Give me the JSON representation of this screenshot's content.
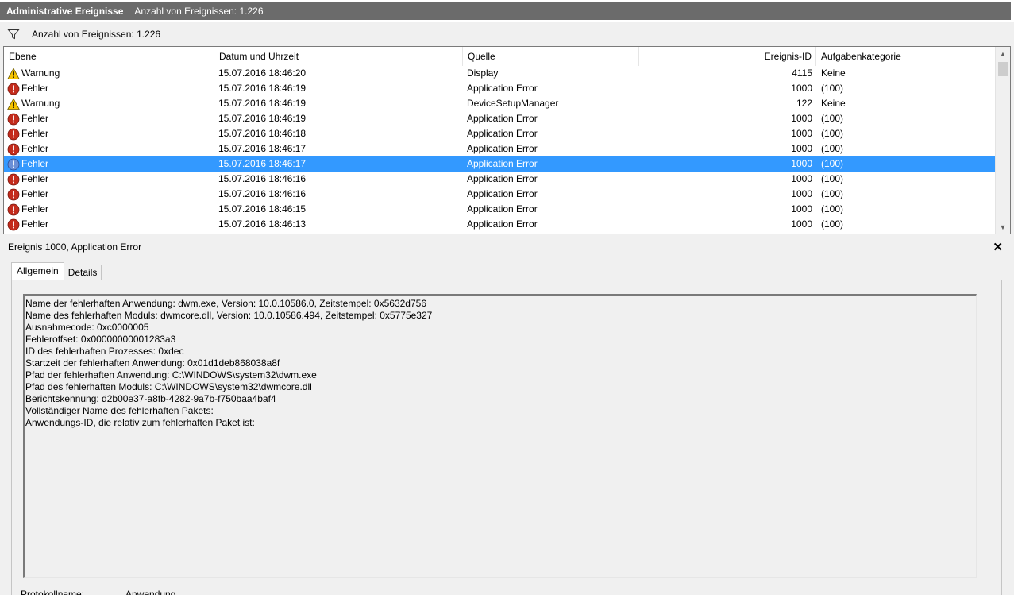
{
  "titlebar": {
    "title": "Administrative Ereignisse",
    "subtitle": "Anzahl von Ereignissen: 1.226"
  },
  "filterbar": {
    "text": "Anzahl von Ereignissen: 1.226",
    "icon": "filter-icon"
  },
  "grid": {
    "columns": [
      "Ebene",
      "Datum und Uhrzeit",
      "Quelle",
      "Ereignis-ID",
      "Aufgabenkategorie"
    ],
    "rows": [
      {
        "level": "Warnung",
        "icon": "warning-icon",
        "date": "15.07.2016 18:46:20",
        "source": "Display",
        "id": "4115",
        "category": "Keine"
      },
      {
        "level": "Fehler",
        "icon": "error-icon",
        "date": "15.07.2016 18:46:19",
        "source": "Application Error",
        "id": "1000",
        "category": "(100)"
      },
      {
        "level": "Warnung",
        "icon": "warning-icon",
        "date": "15.07.2016 18:46:19",
        "source": "DeviceSetupManager",
        "id": "122",
        "category": "Keine"
      },
      {
        "level": "Fehler",
        "icon": "error-icon",
        "date": "15.07.2016 18:46:19",
        "source": "Application Error",
        "id": "1000",
        "category": "(100)"
      },
      {
        "level": "Fehler",
        "icon": "error-icon",
        "date": "15.07.2016 18:46:18",
        "source": "Application Error",
        "id": "1000",
        "category": "(100)"
      },
      {
        "level": "Fehler",
        "icon": "error-icon",
        "date": "15.07.2016 18:46:17",
        "source": "Application Error",
        "id": "1000",
        "category": "(100)"
      },
      {
        "level": "Fehler",
        "icon": "error-icon",
        "date": "15.07.2016 18:46:17",
        "source": "Application Error",
        "id": "1000",
        "category": "(100)",
        "selected": true
      },
      {
        "level": "Fehler",
        "icon": "error-icon",
        "date": "15.07.2016 18:46:16",
        "source": "Application Error",
        "id": "1000",
        "category": "(100)"
      },
      {
        "level": "Fehler",
        "icon": "error-icon",
        "date": "15.07.2016 18:46:16",
        "source": "Application Error",
        "id": "1000",
        "category": "(100)"
      },
      {
        "level": "Fehler",
        "icon": "error-icon",
        "date": "15.07.2016 18:46:15",
        "source": "Application Error",
        "id": "1000",
        "category": "(100)"
      },
      {
        "level": "Fehler",
        "icon": "error-icon",
        "date": "15.07.2016 18:46:13",
        "source": "Application Error",
        "id": "1000",
        "category": "(100)"
      }
    ]
  },
  "detail": {
    "title": "Ereignis 1000, Application Error",
    "close_label": "✕",
    "tabs": [
      "Allgemein",
      "Details"
    ],
    "lines": [
      "Name der fehlerhaften Anwendung: dwm.exe, Version: 10.0.10586.0, Zeitstempel: 0x5632d756",
      "Name des fehlerhaften Moduls: dwmcore.dll, Version: 10.0.10586.494, Zeitstempel: 0x5775e327",
      "Ausnahmecode: 0xc0000005",
      "Fehleroffset: 0x00000000001283a3",
      "ID des fehlerhaften Prozesses: 0xdec",
      "Startzeit der fehlerhaften Anwendung: 0x01d1deb868038a8f",
      "Pfad der fehlerhaften Anwendung: C:\\WINDOWS\\system32\\dwm.exe",
      "Pfad des fehlerhaften Moduls: C:\\WINDOWS\\system32\\dwmcore.dll",
      "Berichtskennung: d2b00e37-a8fb-4282-9a7b-f750baa4baf4",
      "Vollständiger Name des fehlerhaften Pakets:",
      "Anwendungs-ID, die relativ zum fehlerhaften Paket ist:"
    ],
    "log_label": "Protokollname:",
    "log_value": "Anwendung"
  },
  "colors": {
    "selection": "#3399ff",
    "titlebar": "#6b6b6b",
    "error": "#c42b1c",
    "warning": "#f5c400"
  }
}
